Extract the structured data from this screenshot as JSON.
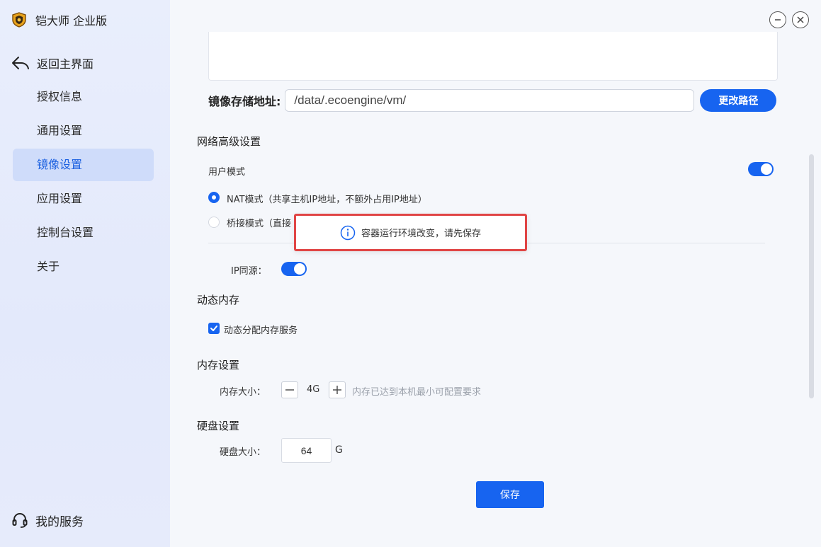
{
  "app": {
    "title": "铠大师 企业版"
  },
  "sidebar": {
    "back_label": "返回主界面",
    "items": [
      {
        "label": "授权信息",
        "active": false
      },
      {
        "label": "通用设置",
        "active": false
      },
      {
        "label": "镜像设置",
        "active": true
      },
      {
        "label": "应用设置",
        "active": false
      },
      {
        "label": "控制台设置",
        "active": false
      },
      {
        "label": "关于",
        "active": false
      }
    ],
    "service_label": "我的服务"
  },
  "image_storage": {
    "label": "镜像存储地址:",
    "path": "/data/.ecoengine/vm/",
    "change_button": "更改路径"
  },
  "network": {
    "title": "网络高级设置",
    "user_mode_label": "用户模式",
    "user_mode_on": true,
    "nat_label": "NAT模式（共享主机IP地址，不额外占用IP地址）",
    "nat_selected": true,
    "bridge_label": "桥接模式（直接",
    "bridge_selected": false,
    "ip_same_source_label": "IP同源：",
    "ip_same_source_on": true
  },
  "dynamic_memory": {
    "title": "动态内存",
    "checkbox_label": "动态分配内存服务",
    "checked": true
  },
  "memory": {
    "title": "内存设置",
    "size_label": "内存大小：",
    "value": "4G",
    "hint": "内存已达到本机最小可配置要求"
  },
  "disk": {
    "title": "硬盘设置",
    "size_label": "硬盘大小：",
    "value": "64",
    "unit": "G"
  },
  "save_button": "保存",
  "toast": {
    "message": "容器运行环境改变，请先保存"
  },
  "colors": {
    "accent": "#1764f0",
    "sidebar_active_bg": "#cfdcfa",
    "toast_border": "#e04545"
  }
}
